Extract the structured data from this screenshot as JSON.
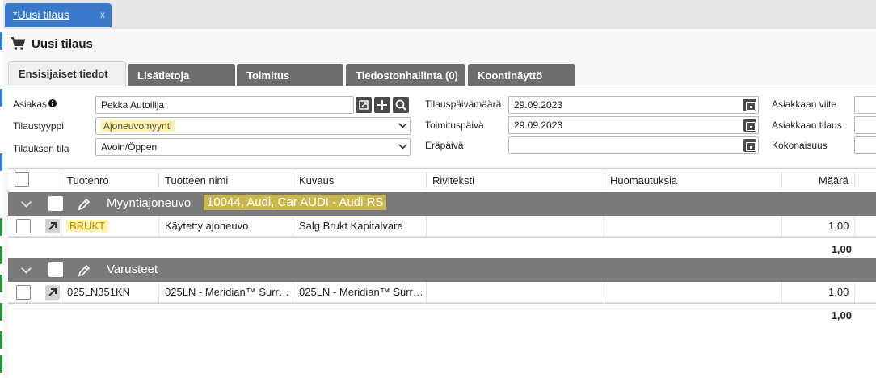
{
  "doc_tab": {
    "label": "*Uusi tilaus",
    "close": "x"
  },
  "page_title": "Uusi tilaus",
  "tabs": [
    {
      "label": "Ensisijaiset tiedot",
      "active": true
    },
    {
      "label": "Lisätietoja",
      "active": false
    },
    {
      "label": "Toimitus",
      "active": false
    },
    {
      "label": "Tiedostonhallinta (0)",
      "active": false
    },
    {
      "label": "Koontinäyttö",
      "active": false
    }
  ],
  "form": {
    "asiakas_label": "Asiakas",
    "asiakas_value": "Pekka Autoilija",
    "tilaustyyppi_label": "Tilaustyyppi",
    "tilaustyyppi_value": "Ajoneuvomyynti",
    "tilauksen_tila_label": "Tilauksen tila",
    "tilauksen_tila_value": "Avoin/Öppen",
    "tilauspaivamaara_label": "Tilauspäivämäärä",
    "tilauspaivamaara_value": "29.09.2023",
    "toimituspaiva_label": "Toimituspäivä",
    "toimituspaiva_value": "29.09.2023",
    "erapaiva_label": "Eräpäivä",
    "erapaiva_value": "",
    "asiakkaan_viite_label": "Asiakkaan viite",
    "asiakkaan_tilaus_label": "Asiakkaan tilaus",
    "kokonaisuus_label": "Kokonaisuus"
  },
  "grid": {
    "columns": [
      "Tuotenro",
      "Tuotteen nimi",
      "Kuvaus",
      "Riviteksti",
      "Huomautuksia",
      "Määrä"
    ],
    "groups": [
      {
        "title": "Myyntiajoneuvo",
        "subtitle": "10044, Audi, Car AUDI - Audi RS",
        "rows": [
          {
            "tuotenro": "BRUKT",
            "nimi": "Käytetty ajoneuvo",
            "kuvaus": "Salg Brukt Kapitalvare",
            "riviteksti": "",
            "huomautuksia": "",
            "maara": "1,00"
          }
        ],
        "total": "1,00"
      },
      {
        "title": "Varusteet",
        "subtitle": "",
        "rows": [
          {
            "tuotenro": "025LN351KN",
            "nimi": "025LN - Meridian™ Surr…",
            "kuvaus": "025LN - Meridian™ Surr…",
            "riviteksti": "",
            "huomautuksia": "",
            "maara": "1,00"
          }
        ],
        "total": "1,00"
      }
    ]
  },
  "colors": {
    "tab_blue": "#3a79c9",
    "tab_grey": "#6d6d6d",
    "group_grey": "#7a7a7a",
    "highlight": "#fff3a6"
  }
}
